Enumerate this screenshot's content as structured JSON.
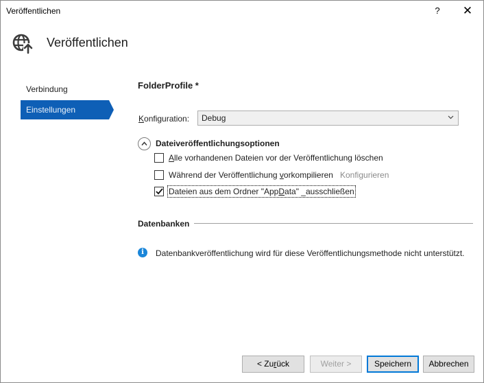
{
  "window": {
    "title": "Veröffentlichen",
    "help": "?",
    "close": "✕"
  },
  "header": {
    "title": "Veröffentlichen",
    "icon": "globe-publish-icon"
  },
  "sidebar": {
    "items": [
      {
        "label": "Verbindung",
        "active": false
      },
      {
        "label": "Einstellungen",
        "active": true
      }
    ]
  },
  "profile": {
    "name": "FolderProfile *"
  },
  "configuration": {
    "label_pre": "",
    "label_access": "K",
    "label_post": "onfiguration:",
    "value": "Debug"
  },
  "file_options": {
    "title": "Dateiveröffentlichungsoptionen",
    "items": [
      {
        "label_access": "A",
        "label_rest": "lle vorhandenen Dateien vor der Veröffentlichung löschen",
        "checked": false
      },
      {
        "label_pre": "Während der Veröffentlichung ",
        "label_access": "v",
        "label_rest": "orkompilieren",
        "checked": false,
        "link": "Konfigurieren"
      },
      {
        "label_pre": "Dateien aus dem Ordner \"App",
        "label_access": "D",
        "label_rest": "ata\" _ausschließen",
        "checked": true
      }
    ]
  },
  "databases": {
    "title": "Datenbanken",
    "info": "Datenbankveröffentlichung wird für diese Veröffentlichungsmethode nicht unterstützt."
  },
  "buttons": {
    "back_pre": "< Zu",
    "back_access": "r",
    "back_post": "ück",
    "next": "Weiter >",
    "save": "Speichern",
    "cancel": "Abbrechen"
  }
}
